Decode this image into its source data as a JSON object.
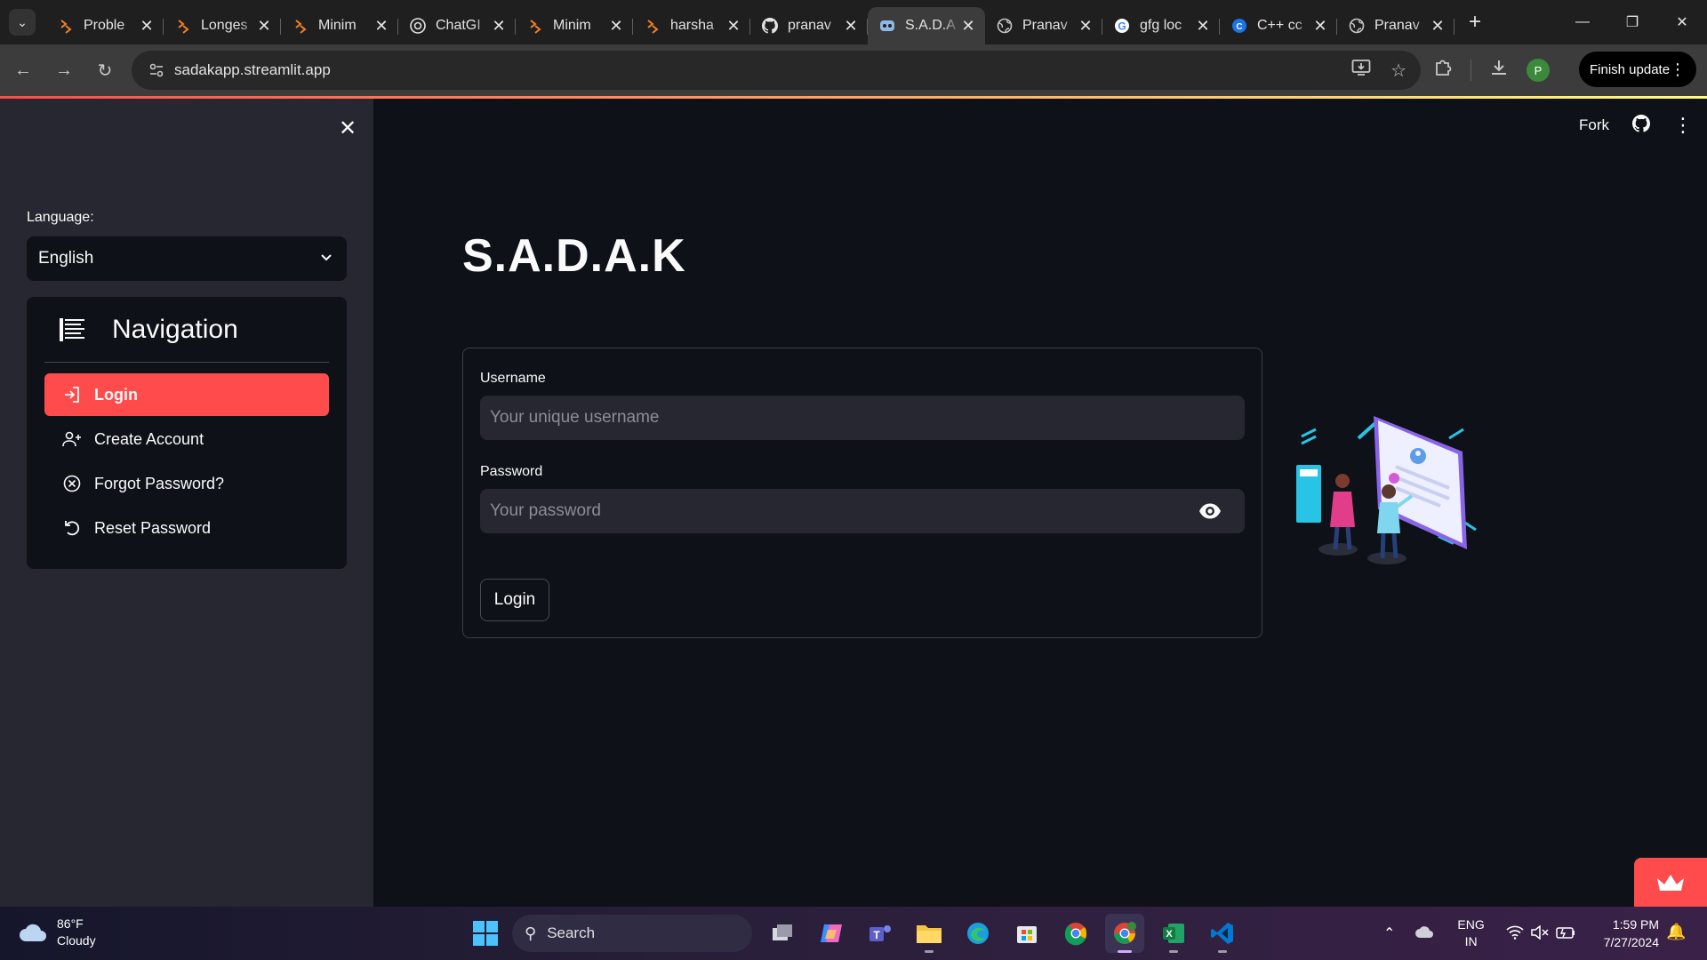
{
  "browser": {
    "tabs": [
      {
        "title": "Proble",
        "icon": "codeforces-icon",
        "active": false
      },
      {
        "title": "Longes",
        "icon": "codeforces-icon",
        "active": false
      },
      {
        "title": "Minim",
        "icon": "codeforces-icon",
        "active": false
      },
      {
        "title": "ChatGI",
        "icon": "chatgpt-icon",
        "active": false
      },
      {
        "title": "Minim",
        "icon": "codeforces-icon",
        "active": false
      },
      {
        "title": "harsha",
        "icon": "codeforces-icon",
        "active": false
      },
      {
        "title": "pranav",
        "icon": "github-icon",
        "active": false
      },
      {
        "title": "S.A.D.A",
        "icon": "streamlit-icon",
        "active": true
      },
      {
        "title": "Pranav",
        "icon": "globe-icon",
        "active": false
      },
      {
        "title": "gfg loc",
        "icon": "google-icon",
        "active": false
      },
      {
        "title": "C++ cc",
        "icon": "cplusplus-icon",
        "active": false
      },
      {
        "title": "Pranav",
        "icon": "globe-icon",
        "active": false
      }
    ],
    "url": "sadakapp.streamlit.app",
    "profile_initial": "P",
    "finish_update_label": "Finish update"
  },
  "sidebar": {
    "language_label": "Language:",
    "language_value": "English",
    "nav_title": "Navigation",
    "nav_items": [
      {
        "label": "Login",
        "icon": "login-icon",
        "active": true
      },
      {
        "label": "Create Account",
        "icon": "add-user-icon",
        "active": false
      },
      {
        "label": "Forgot Password?",
        "icon": "cancel-circle-icon",
        "active": false
      },
      {
        "label": "Reset Password",
        "icon": "reset-icon",
        "active": false
      }
    ]
  },
  "header": {
    "fork_label": "Fork"
  },
  "main": {
    "title": "S.A.D.A.K",
    "username_label": "Username",
    "username_placeholder": "Your unique username",
    "password_label": "Password",
    "password_placeholder": "Your password",
    "login_button": "Login"
  },
  "taskbar": {
    "weather_temp": "86°F",
    "weather_desc": "Cloudy",
    "search_label": "Search",
    "language_line1": "ENG",
    "language_line2": "IN",
    "time": "1:59 PM",
    "date": "7/27/2024"
  },
  "colors": {
    "accent": "#ff4b4b",
    "background": "#0e1117",
    "sidebar": "#262730"
  }
}
